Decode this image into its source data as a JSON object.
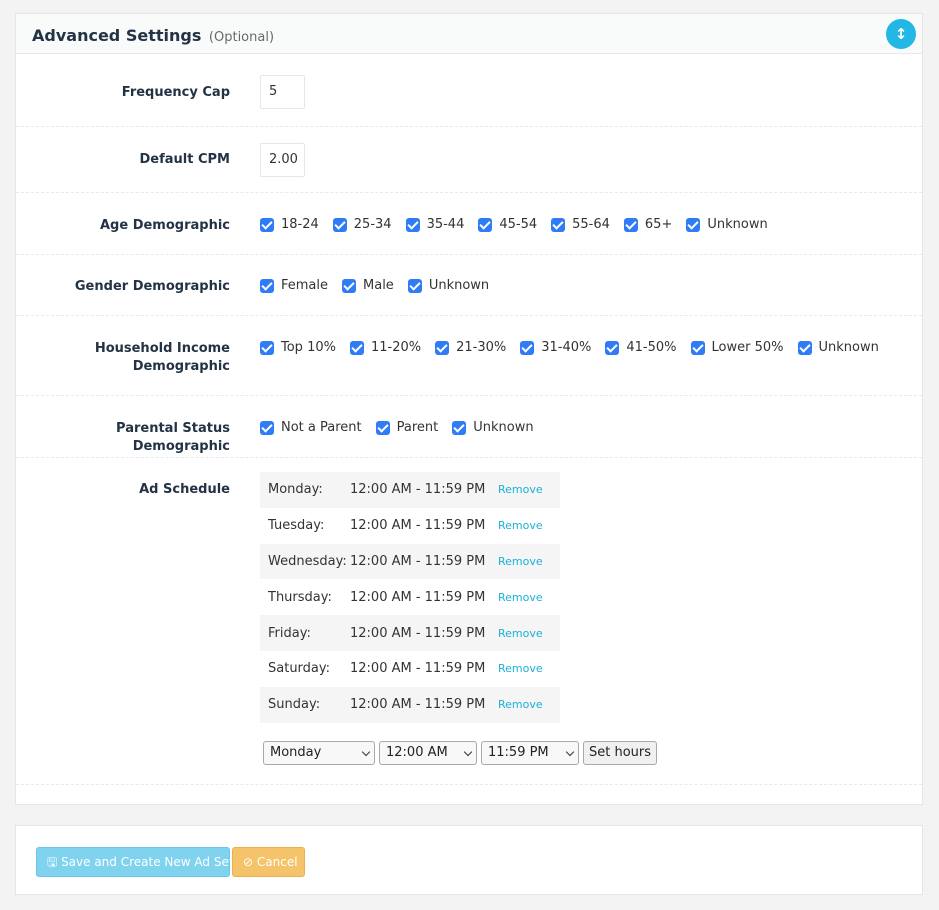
{
  "panel": {
    "title": "Advanced Settings",
    "subtitle": "(Optional)",
    "info_icon": "info-icon"
  },
  "frequency_cap": {
    "label": "Frequency Cap",
    "value": "5"
  },
  "default_cpm": {
    "label": "Default CPM",
    "value": "2.00"
  },
  "age": {
    "label": "Age Demographic",
    "options": [
      "18-24",
      "25-34",
      "35-44",
      "45-54",
      "55-64",
      "65+",
      "Unknown"
    ]
  },
  "gender": {
    "label": "Gender Demographic",
    "options": [
      "Female",
      "Male",
      "Unknown"
    ]
  },
  "income": {
    "label_line1": "Household Income",
    "label_line2": "Demographic",
    "options": [
      "Top 10%",
      "11-20%",
      "21-30%",
      "31-40%",
      "41-50%",
      "Lower 50%",
      "Unknown"
    ]
  },
  "parental": {
    "label": "Parental Status Demographic",
    "options": [
      "Not a Parent",
      "Parent",
      "Unknown"
    ]
  },
  "schedule": {
    "label": "Ad Schedule",
    "remove_label": "Remove",
    "rows": [
      {
        "day": "Monday:",
        "time": "12:00 AM - 11:59 PM"
      },
      {
        "day": "Tuesday:",
        "time": "12:00 AM - 11:59 PM"
      },
      {
        "day": "Wednesday:",
        "time": "12:00 AM - 11:59 PM"
      },
      {
        "day": "Thursday:",
        "time": "12:00 AM - 11:59 PM"
      },
      {
        "day": "Friday:",
        "time": "12:00 AM - 11:59 PM"
      },
      {
        "day": "Saturday:",
        "time": "12:00 AM - 11:59 PM"
      },
      {
        "day": "Sunday:",
        "time": "12:00 AM - 11:59 PM"
      }
    ],
    "day_select": "Monday",
    "start_select": "12:00 AM",
    "end_select": "11:59 PM",
    "set_hours_label": "Set hours"
  },
  "footer": {
    "save_label": "Save and Create New Ad Set",
    "cancel_label": "Cancel"
  },
  "colors": {
    "accent": "#23b7e5",
    "checkbox": "#2f7cf6",
    "save_button": "#7fd3ef",
    "cancel_button": "#f5c369",
    "remove_link": "#1ab1d6"
  }
}
